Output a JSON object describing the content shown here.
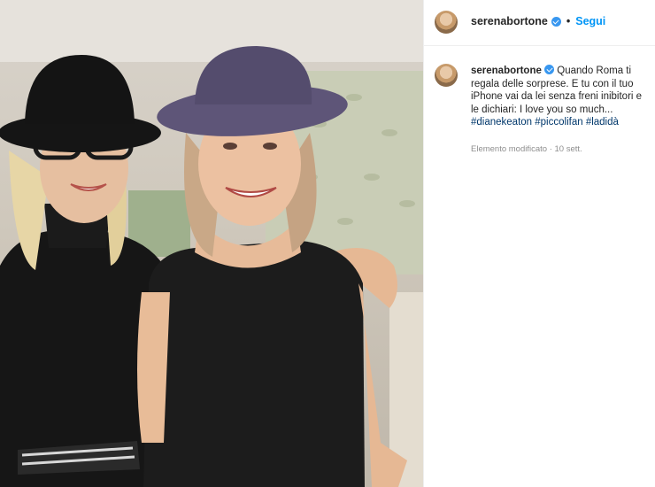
{
  "post": {
    "username": "serenabortone",
    "follow_label": "Segui",
    "separator": "•"
  },
  "caption": {
    "username": "serenabortone",
    "text": "Quando Roma ti regala delle sorprese. E tu con il tuo iPhone vai da lei senza freni inibitori e le dichiari: I love you so much...",
    "hashtags": [
      "#dianekeaton",
      "#piccolifan",
      "#ladidà"
    ],
    "meta": "Elemento modificato · 10 sett."
  },
  "icons": {
    "verified": "verified-badge-icon",
    "avatar": "avatar"
  },
  "colors": {
    "link_blue": "#0095f6",
    "hashtag_blue": "#00376b",
    "muted_gray": "#8e8e8e",
    "verified_blue": "#3897f0"
  }
}
